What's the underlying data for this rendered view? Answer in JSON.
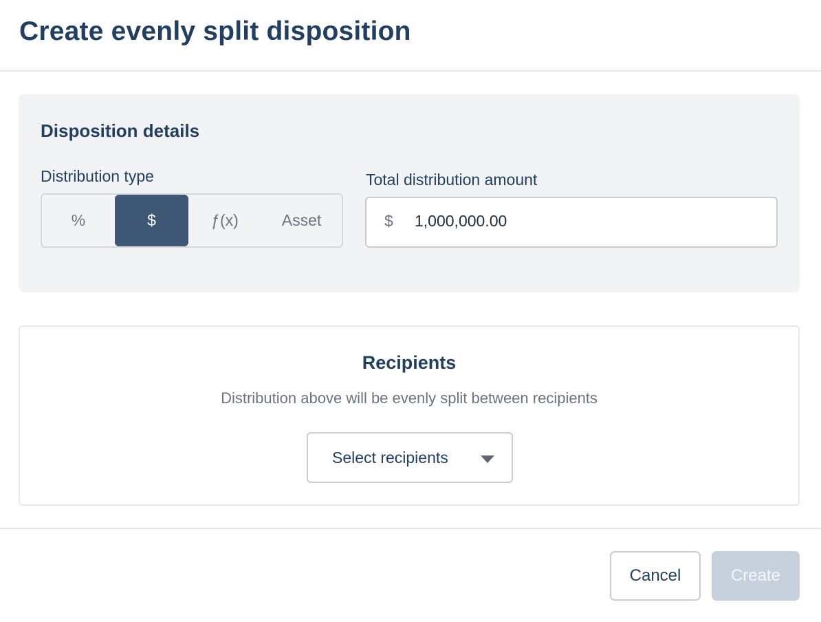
{
  "dialog": {
    "title": "Create evenly split disposition"
  },
  "details": {
    "heading": "Disposition details",
    "distribution_type_label": "Distribution type",
    "options": [
      {
        "label": "%",
        "selected": false
      },
      {
        "label": "$",
        "selected": true
      },
      {
        "label": "ƒ(x)",
        "selected": false
      },
      {
        "label": "Asset",
        "selected": false
      }
    ],
    "total_amount_label": "Total distribution amount",
    "currency_symbol": "$",
    "total_amount_value": "1,000,000.00"
  },
  "recipients": {
    "heading": "Recipients",
    "description": "Distribution above will be evenly split between recipients",
    "select_label": "Select recipients"
  },
  "footer": {
    "cancel_label": "Cancel",
    "create_label": "Create"
  },
  "colors": {
    "title": "#223f62",
    "selected_segment": "#3d5775",
    "panel_background": "#f2f3f5",
    "create_disabled": "#c7d1dd"
  }
}
